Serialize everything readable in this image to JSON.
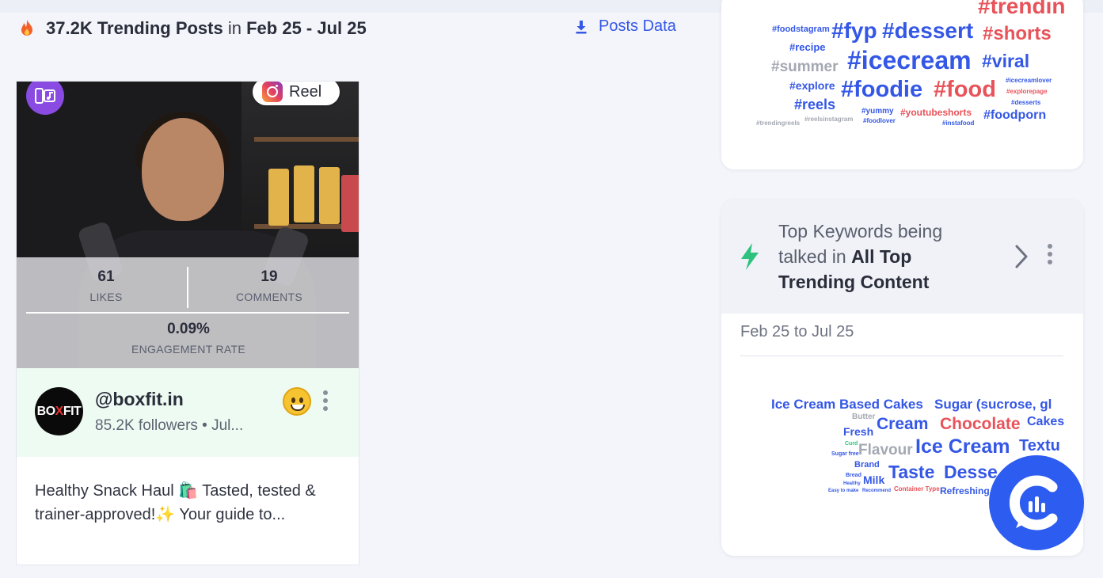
{
  "header": {
    "count": "37.2K Trending Posts",
    "in_word": "in",
    "date_range": "Feb 25 - Jul 25",
    "posts_data_label": "Posts Data",
    "fire_icon": "fire-icon",
    "download_icon": "download-icon"
  },
  "post": {
    "platform_label": "Reel",
    "stats": {
      "likes_value": "61",
      "likes_label": "LIKES",
      "comments_value": "19",
      "comments_label": "COMMENTS",
      "engagement_value": "0.09%",
      "engagement_label": "ENGAGEMENT RATE"
    },
    "author": {
      "avatar_text_a": "BO",
      "avatar_text_x": "X",
      "avatar_text_b": "FIT",
      "handle": "@boxfit.in",
      "followers": "85.2K followers • Jul..."
    },
    "caption": "Healthy Snack Haul 🛍️ Tasted, tested & trainer-approved!✨ Your guide to..."
  },
  "hashtags": {
    "words": [
      {
        "text": "#trendin",
        "color": "red"
      },
      {
        "text": "#foodstagram",
        "color": "blue"
      },
      {
        "text": "#fyp",
        "color": "blue"
      },
      {
        "text": "#dessert",
        "color": "blue"
      },
      {
        "text": "#shorts",
        "color": "red"
      },
      {
        "text": "#recipe",
        "color": "blue"
      },
      {
        "text": "#summer",
        "color": "grey"
      },
      {
        "text": "#icecream",
        "color": "blue"
      },
      {
        "text": "#viral",
        "color": "blue"
      },
      {
        "text": "#explore",
        "color": "blue"
      },
      {
        "text": "#foodie",
        "color": "blue"
      },
      {
        "text": "#food",
        "color": "red"
      },
      {
        "text": "#icecreamlover",
        "color": "blue"
      },
      {
        "text": "#explorepage",
        "color": "red"
      },
      {
        "text": "#reels",
        "color": "blue"
      },
      {
        "text": "#desserts",
        "color": "blue"
      },
      {
        "text": "#yummy",
        "color": "blue"
      },
      {
        "text": "#youtubeshorts",
        "color": "red"
      },
      {
        "text": "#foodporn",
        "color": "blue"
      },
      {
        "text": "#trendingreels",
        "color": "grey"
      },
      {
        "text": "#reelsinstagram",
        "color": "grey"
      },
      {
        "text": "#foodlover",
        "color": "blue"
      },
      {
        "text": "#instafood",
        "color": "blue"
      }
    ]
  },
  "keywords": {
    "title_prefix": "Top Keywords being talked in",
    "title_bold": "All Top Trending Content",
    "date_range": "Feb 25 to Jul 25",
    "words": [
      {
        "text": "Ice Cream Based Cakes",
        "color": "blue"
      },
      {
        "text": "Sugar (sucrose, gl",
        "color": "blue"
      },
      {
        "text": "Butter",
        "color": "grey"
      },
      {
        "text": "Cream",
        "color": "blue"
      },
      {
        "text": "Chocolate",
        "color": "red"
      },
      {
        "text": "Cakes",
        "color": "blue"
      },
      {
        "text": "Fresh",
        "color": "blue"
      },
      {
        "text": "Curd",
        "color": "green"
      },
      {
        "text": "Flavour",
        "color": "grey"
      },
      {
        "text": "Ice Cream",
        "color": "blue"
      },
      {
        "text": "Textu",
        "color": "blue"
      },
      {
        "text": "Sugar free",
        "color": "blue"
      },
      {
        "text": "Brand",
        "color": "blue"
      },
      {
        "text": "Bread",
        "color": "blue"
      },
      {
        "text": "Taste",
        "color": "blue"
      },
      {
        "text": "Desse",
        "color": "blue"
      },
      {
        "text": "Milk",
        "color": "blue"
      },
      {
        "text": "Healthy",
        "color": "blue"
      },
      {
        "text": "Easy to make",
        "color": "blue"
      },
      {
        "text": "Recommend",
        "color": "blue"
      },
      {
        "text": "Container Type",
        "color": "red"
      },
      {
        "text": "Refreshing",
        "color": "blue"
      }
    ]
  },
  "colors": {
    "accent": "#3457e6",
    "red": "#e8535a",
    "grey": "#a4a8b2",
    "green": "#2ec27e",
    "fab": "#2d5cf0"
  }
}
